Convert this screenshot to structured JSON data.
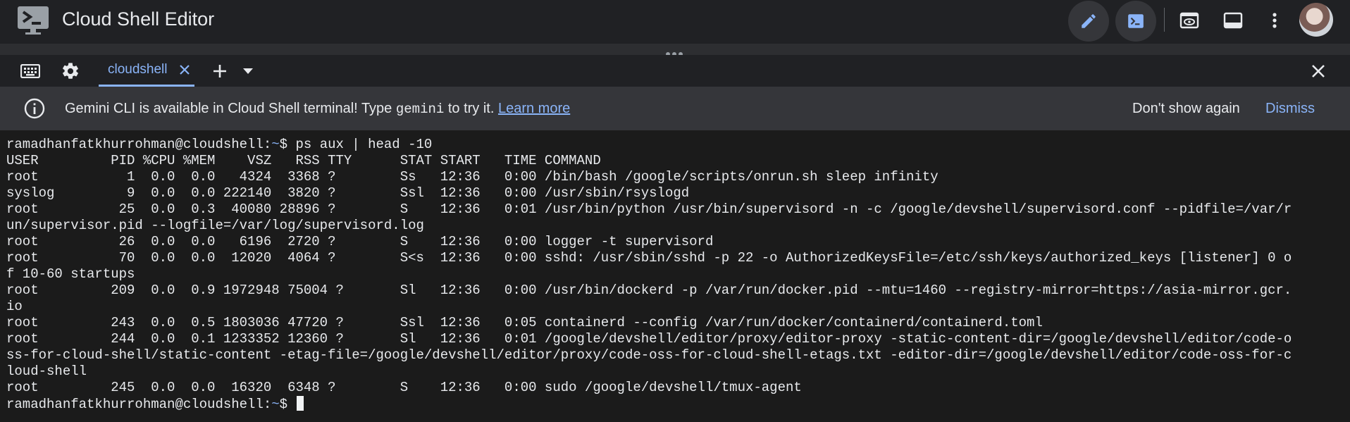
{
  "header": {
    "title": "Cloud Shell Editor",
    "icons": {
      "logo": "terminal-monitor-icon",
      "edit": "pencil-icon",
      "terminal": "terminal-prompt-icon",
      "preview": "eye-preview-icon",
      "panel": "panel-toggle-icon",
      "more": "more-vert-icon"
    }
  },
  "tabbar": {
    "tab_label": "cloudshell"
  },
  "banner": {
    "text_before": "Gemini CLI is available in Cloud Shell terminal! Type ",
    "command": "gemini",
    "text_after": " to try it. ",
    "learn_more": "Learn more",
    "dont_show": "Don't show again",
    "dismiss": "Dismiss"
  },
  "terminal": {
    "prompt_user": "ramadhanfatkhurrohman@cloudshell:",
    "prompt_path": "~",
    "prompt_suffix": "$ ",
    "command": "ps aux | head -10",
    "output": [
      "USER         PID %CPU %MEM    VSZ   RSS TTY      STAT START   TIME COMMAND",
      "root           1  0.0  0.0   4324  3368 ?        Ss   12:36   0:00 /bin/bash /google/scripts/onrun.sh sleep infinity",
      "syslog         9  0.0  0.0 222140  3820 ?        Ssl  12:36   0:00 /usr/sbin/rsyslogd",
      "root          25  0.0  0.3  40080 28896 ?        S    12:36   0:01 /usr/bin/python /usr/bin/supervisord -n -c /google/devshell/supervisord.conf --pidfile=/var/r",
      "un/supervisor.pid --logfile=/var/log/supervisord.log",
      "root          26  0.0  0.0   6196  2720 ?        S    12:36   0:00 logger -t supervisord",
      "root          70  0.0  0.0  12020  4064 ?        S<s  12:36   0:00 sshd: /usr/sbin/sshd -p 22 -o AuthorizedKeysFile=/etc/ssh/keys/authorized_keys [listener] 0 o",
      "f 10-60 startups",
      "root         209  0.0  0.9 1972948 75004 ?       Sl   12:36   0:00 /usr/bin/dockerd -p /var/run/docker.pid --mtu=1460 --registry-mirror=https://asia-mirror.gcr.",
      "io",
      "root         243  0.0  0.5 1803036 47720 ?       Ssl  12:36   0:05 containerd --config /var/run/docker/containerd/containerd.toml",
      "root         244  0.0  0.1 1233352 12360 ?       Sl   12:36   0:01 /google/devshell/editor/proxy/editor-proxy -static-content-dir=/google/devshell/editor/code-o",
      "ss-for-cloud-shell/static-content -etag-file=/google/devshell/editor/proxy/code-oss-for-cloud-shell-etags.txt -editor-dir=/google/devshell/editor/code-oss-for-c",
      "loud-shell",
      "root         245  0.0  0.0  16320  6348 ?        S    12:36   0:00 sudo /google/devshell/tmux-agent"
    ]
  },
  "colors": {
    "accent": "#8ab4f8",
    "background": "#202124",
    "banner": "#35363a",
    "terminal_bg": "#1b1b1b"
  }
}
